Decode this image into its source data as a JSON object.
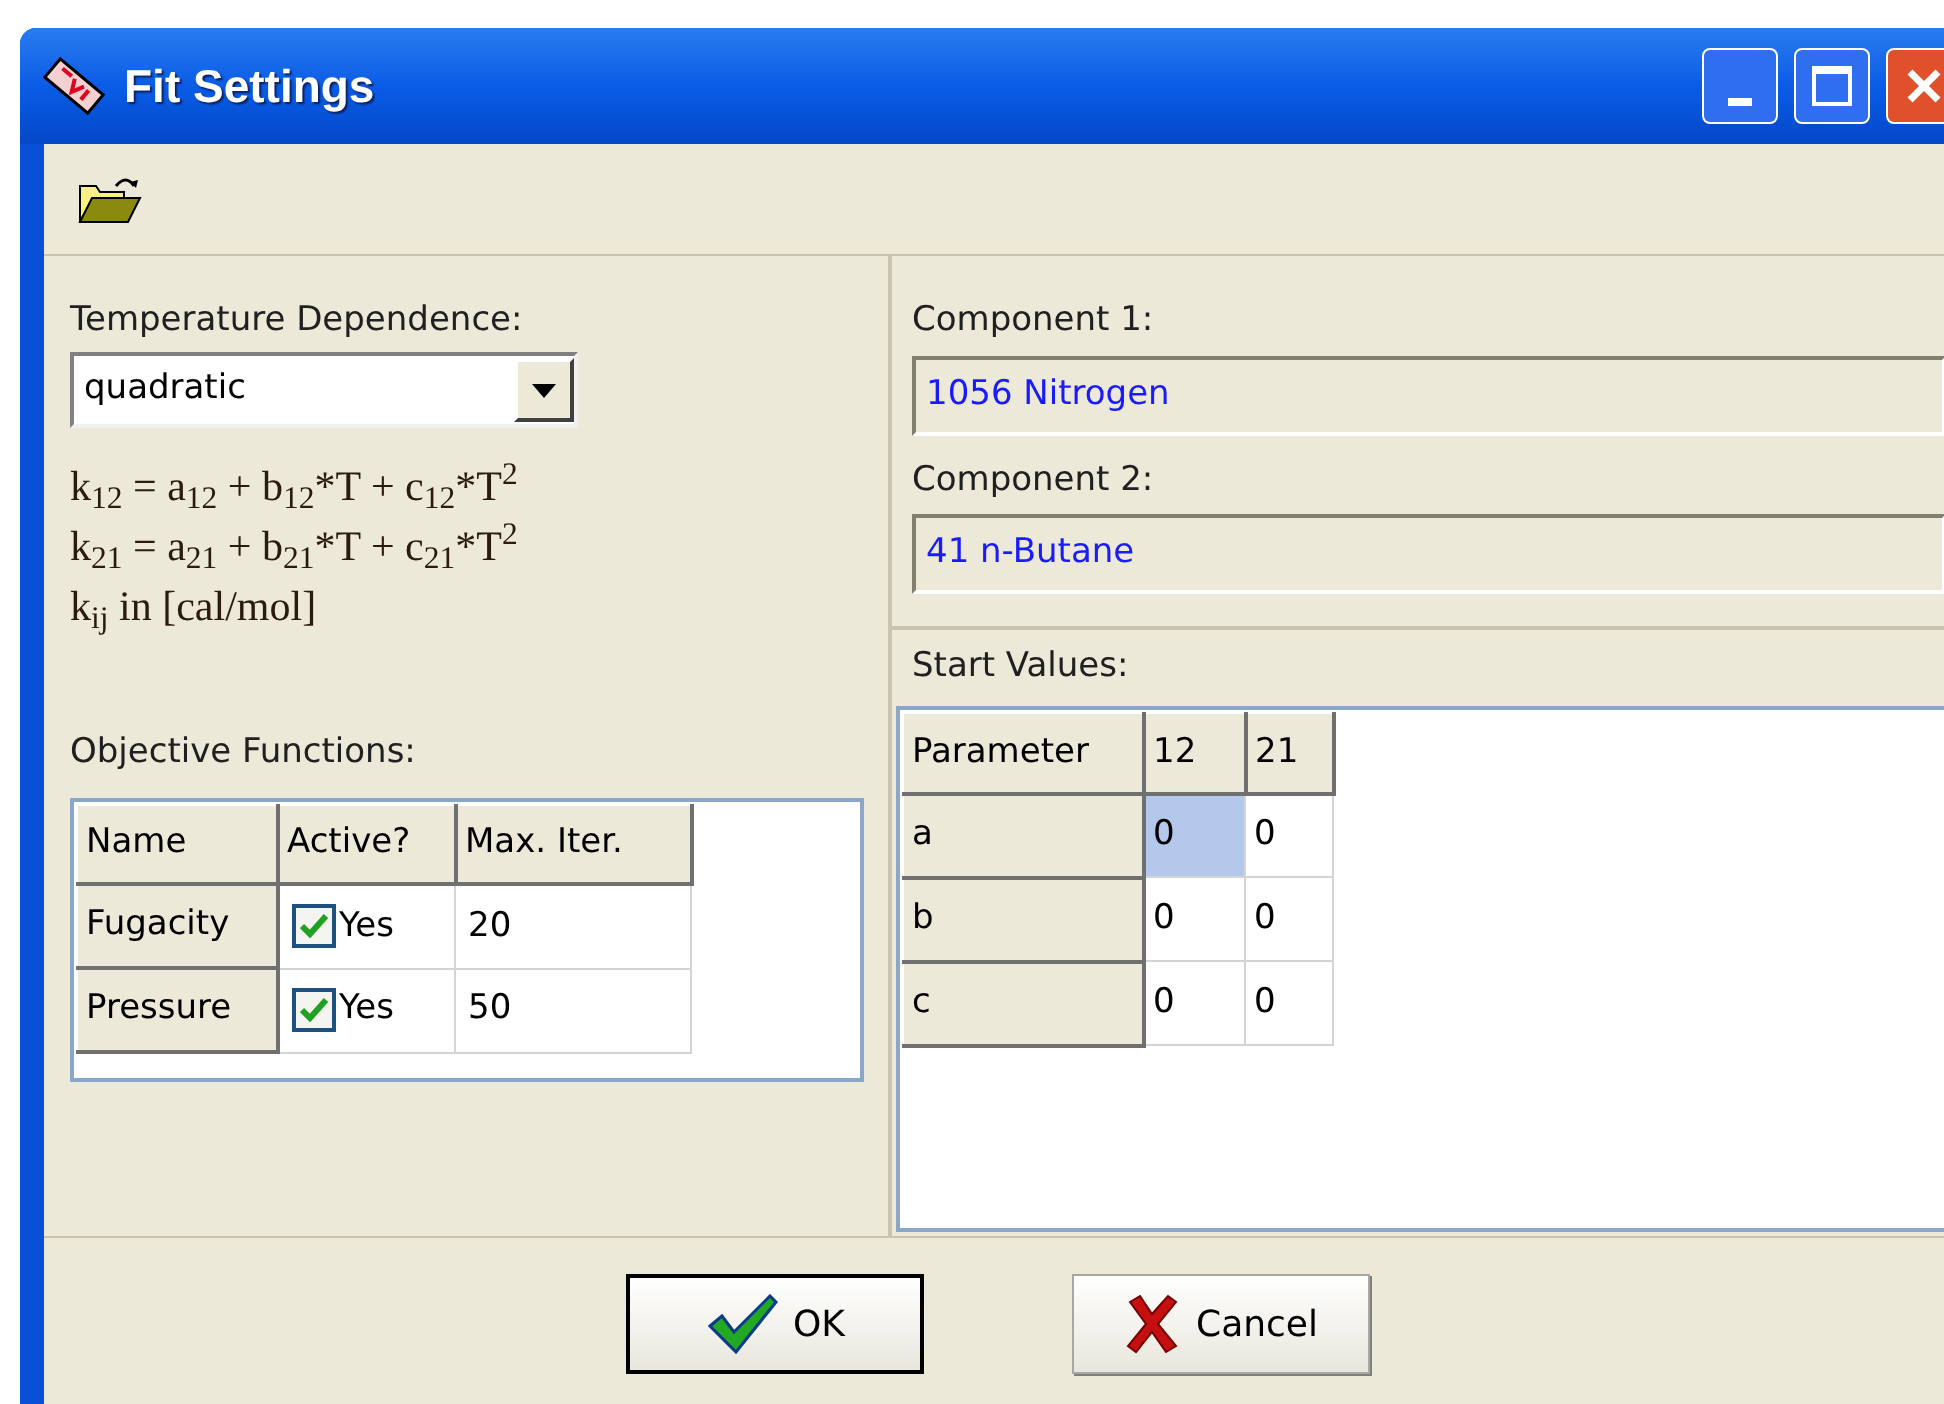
{
  "window": {
    "title": "Fit Settings"
  },
  "temperature_dependence": {
    "label": "Temperature Dependence:",
    "value": "quadratic"
  },
  "formulas": [
    "k$_{12}$ = a$_{12}$ + b$_{12}$*T + c$_{12}$*T$^{2}$",
    "k$_{21}$ = a$_{21}$ + b$_{21}$*T + c$_{21}$*T$^{2}$",
    "k$_{ij}$ in [cal/mol]"
  ],
  "objective_functions": {
    "label": "Objective Functions:",
    "columns": [
      "Name",
      "Active?",
      "Max. Iter."
    ],
    "rows": [
      {
        "name": "Fugacity",
        "active": true,
        "active_label": "Yes",
        "max_iter": "20"
      },
      {
        "name": "Pressure",
        "active": true,
        "active_label": "Yes",
        "max_iter": "50"
      }
    ]
  },
  "components": [
    {
      "label": "Component 1:",
      "value": "1056 Nitrogen"
    },
    {
      "label": "Component 2:",
      "value": "41 n-Butane"
    }
  ],
  "start_values": {
    "label": "Start Values:",
    "columns": [
      "Parameter",
      "12",
      "21"
    ],
    "rows": [
      {
        "parameter": "a",
        "values": [
          {
            "text": "0",
            "selected": true
          },
          {
            "text": "0",
            "selected": false
          }
        ]
      },
      {
        "parameter": "b",
        "values": [
          {
            "text": "0",
            "selected": false
          },
          {
            "text": "0",
            "selected": false
          }
        ]
      },
      {
        "parameter": "c",
        "values": [
          {
            "text": "0",
            "selected": false
          },
          {
            "text": "0",
            "selected": false
          }
        ]
      }
    ]
  },
  "buttons": [
    {
      "kind": "ok",
      "label": "OK",
      "default": true
    },
    {
      "kind": "cancel",
      "label": "Cancel",
      "default": false
    }
  ]
}
